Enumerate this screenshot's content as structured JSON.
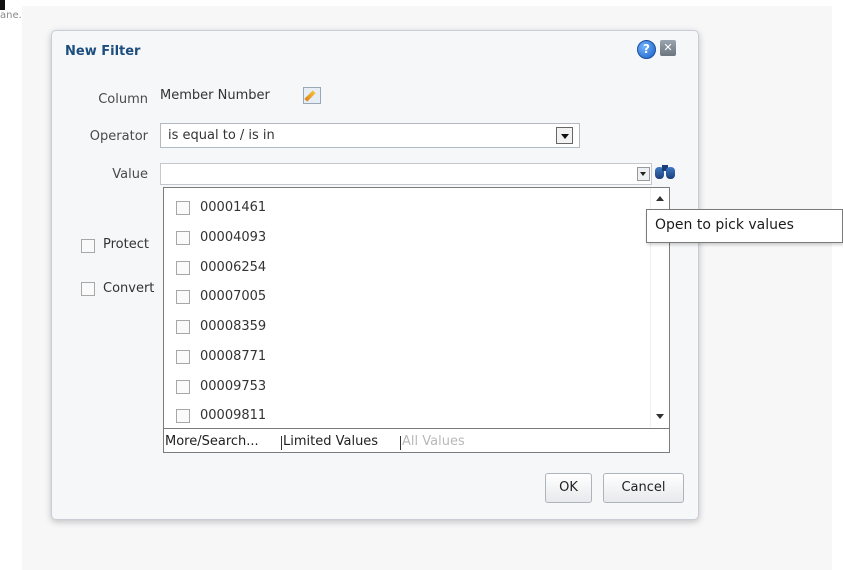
{
  "background": {
    "partial_text": "ane."
  },
  "dialog": {
    "title": "New Filter",
    "help_symbol": "?",
    "close_symbol": "✕",
    "column_label": "Column",
    "column_value": "Member Number",
    "operator_label": "Operator",
    "operator_value": "is equal to / is in",
    "value_label": "Value",
    "value_input": "",
    "protect_label": "Protect",
    "convert_label": "Convert",
    "ok_label": "OK",
    "cancel_label": "Cancel"
  },
  "dropdown": {
    "items": [
      "00001461",
      "00004093",
      "00006254",
      "00007005",
      "00008359",
      "00008771",
      "00009753",
      "00009811"
    ],
    "footer": {
      "more_search": "More/Search...",
      "limited_values": "Limited Values",
      "all_values": "All Values"
    }
  },
  "tooltip": {
    "text": "Open to pick values"
  },
  "icons": {
    "help": "help-icon",
    "close": "close-icon",
    "edit": "edit-icon",
    "binoculars": "binoculars-icon",
    "dropdown_arrow": "chevron-down-icon",
    "scroll_up": "scroll-up-icon",
    "scroll_down": "scroll-down-icon"
  }
}
